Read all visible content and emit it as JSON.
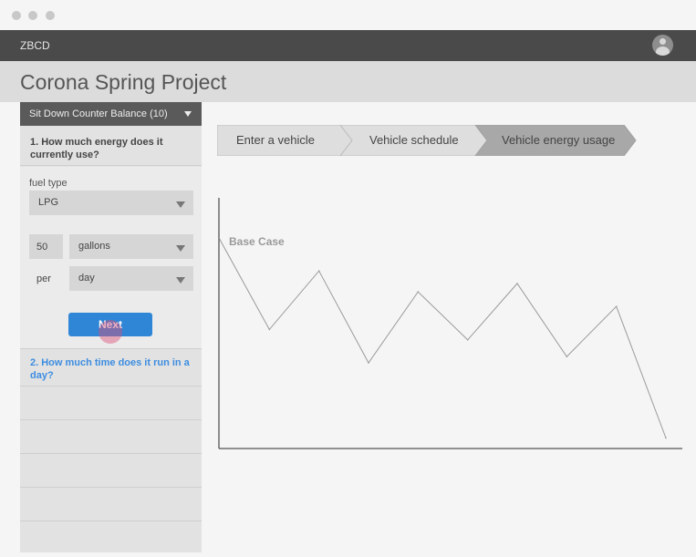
{
  "window": {
    "controls": [
      "close",
      "minimize",
      "maximize"
    ]
  },
  "topnav": {
    "brand": "ZBCD",
    "avatar_icon": "user-avatar-icon"
  },
  "header": {
    "title": "Corona Spring Project"
  },
  "sidebar": {
    "vehicle_select": "Sit Down Counter Balance (10)",
    "question1": "1. How much energy does it currently use?",
    "fuel_type_label": "fuel type",
    "fuel_type_value": "LPG",
    "quantity_value": "50",
    "unit_value": "gallons",
    "per_label": "per",
    "period_value": "day",
    "next_button": "Next",
    "question2": "2. How much time does it run in a day?"
  },
  "steps": [
    {
      "label": "Enter a vehicle",
      "state": "complete"
    },
    {
      "label": "Vehicle schedule",
      "state": "complete"
    },
    {
      "label": "Vehicle energy usage",
      "state": "active"
    }
  ],
  "colors": {
    "topnav": "#4a4a4a",
    "header": "#dcdcdc",
    "accent_button": "#2f86d6",
    "question_link": "#3d8de0",
    "step_active": "#a8a8a8",
    "step_default": "#dedede"
  },
  "chart_data": {
    "type": "line",
    "title": "Base Case",
    "series": [
      {
        "values": [
          1.0,
          0.57,
          0.85,
          0.41,
          0.75,
          0.52,
          0.79,
          0.44,
          0.68,
          0.05
        ]
      }
    ],
    "ylim": [
      0,
      1.2
    ],
    "grid": false
  }
}
